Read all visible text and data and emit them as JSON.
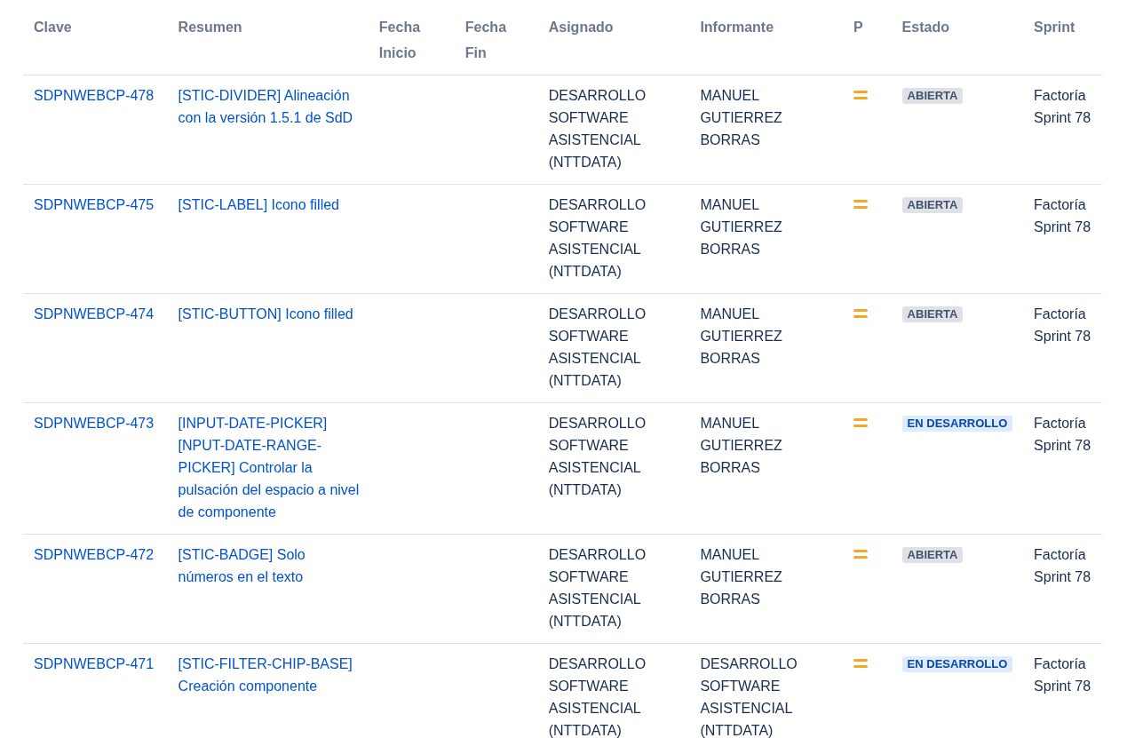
{
  "table": {
    "columns": [
      "Clave",
      "Resumen",
      "Fecha Inicio",
      "Fecha Fin",
      "Asignado",
      "Informante",
      "P",
      "Estado",
      "Sprint"
    ],
    "rows": [
      {
        "key": "SDPNWEBCP-478",
        "summary": "[STIC-DIVIDER] Alineación con la versión 1.5.1 de SdD",
        "assignee": "DESARROLLO SOFTWARE ASISTENCIAL (NTTDATA)",
        "reporter": "MANUEL GUTIERREZ BORRAS",
        "status": {
          "label": "ABIERTA",
          "kind": "open"
        },
        "sprint": "Factoría Sprint 78"
      },
      {
        "key": "SDPNWEBCP-475",
        "summary": "[STIC-LABEL] Icono filled",
        "assignee": "DESARROLLO SOFTWARE ASISTENCIAL (NTTDATA)",
        "reporter": "MANUEL GUTIERREZ BORRAS",
        "status": {
          "label": "ABIERTA",
          "kind": "open"
        },
        "sprint": "Factoría Sprint 78"
      },
      {
        "key": "SDPNWEBCP-474",
        "summary": "[STIC-BUTTON] Icono filled",
        "assignee": "DESARROLLO SOFTWARE ASISTENCIAL (NTTDATA)",
        "reporter": "MANUEL GUTIERREZ BORRAS",
        "status": {
          "label": "ABIERTA",
          "kind": "open"
        },
        "sprint": "Factoría Sprint 78"
      },
      {
        "key": "SDPNWEBCP-473",
        "summary": "[INPUT-DATE-PICKER] [NPUT-DATE-RANGE-PICKER] Controlar la pulsación del espacio a nivel de componente",
        "assignee": "DESARROLLO SOFTWARE ASISTENCIAL (NTTDATA)",
        "reporter": "MANUEL GUTIERREZ BORRAS",
        "status": {
          "label": "EN DESARROLLO",
          "kind": "progress"
        },
        "sprint": "Factoría Sprint 78"
      },
      {
        "key": "SDPNWEBCP-472",
        "summary": "[STIC-BADGE] Solo números en el texto",
        "assignee": "DESARROLLO SOFTWARE ASISTENCIAL (NTTDATA)",
        "reporter": "MANUEL GUTIERREZ BORRAS",
        "status": {
          "label": "ABIERTA",
          "kind": "open"
        },
        "sprint": "Factoría Sprint 78"
      },
      {
        "key": "SDPNWEBCP-471",
        "summary": "[STIC-FILTER-CHIP-BASE] Creación componente",
        "assignee": "DESARROLLO SOFTWARE ASISTENCIAL (NTTDATA)",
        "reporter": "DESARROLLO SOFTWARE ASISTENCIAL (NTTDATA)",
        "status": {
          "label": "EN DESARROLLO",
          "kind": "progress"
        },
        "sprint": "Factoría Sprint 78"
      }
    ]
  }
}
